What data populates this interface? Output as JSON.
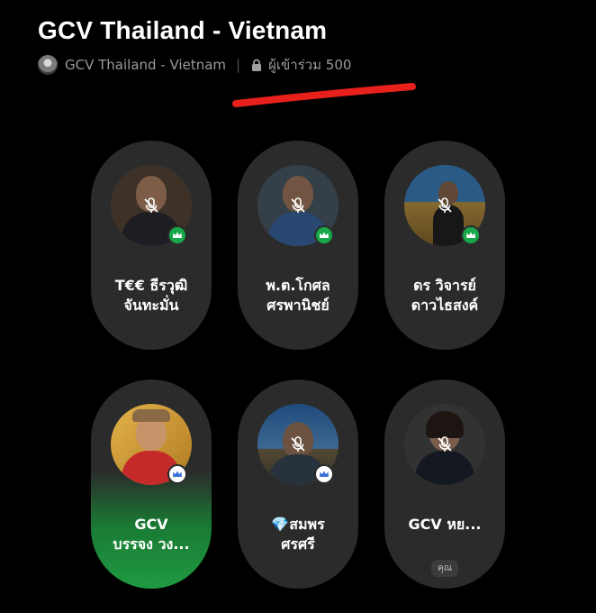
{
  "header": {
    "title": "GCV Thailand - Vietnam",
    "group_name": "GCV Thailand - Vietnam",
    "participants_label": "ผู้เข้าร่วม 500"
  },
  "participants": [
    {
      "line1": "T€€ ธีรวุฒิ",
      "line2": "จันทะมั่น",
      "role": "admin",
      "muted": true
    },
    {
      "line1": "พ.ต.โกศล",
      "line2": "ศรพานิชย์",
      "role": "admin",
      "muted": true
    },
    {
      "line1": "ดร วิจารย์",
      "line2": "ดาวไธสงค์",
      "role": "admin",
      "muted": true
    },
    {
      "line1": "GCV",
      "line2": "บรรจง วง...",
      "role": "moderator",
      "muted": false,
      "speaking": true
    },
    {
      "line1": "💎สมพร",
      "line2": "ศรศรี",
      "role": "moderator",
      "muted": true
    },
    {
      "line1": "GCV หย...",
      "line2": "",
      "role": "",
      "muted": true,
      "you_label": "คุณ"
    }
  ],
  "colors": {
    "background": "#000000",
    "card": "#2b2b2b",
    "admin_badge": "#18a84a",
    "speaking_glow": "#1f9a40",
    "annotation_stroke": "#e8201c"
  },
  "icons": [
    "lock-icon",
    "mic-off-icon",
    "crown-icon",
    "group-avatar"
  ]
}
